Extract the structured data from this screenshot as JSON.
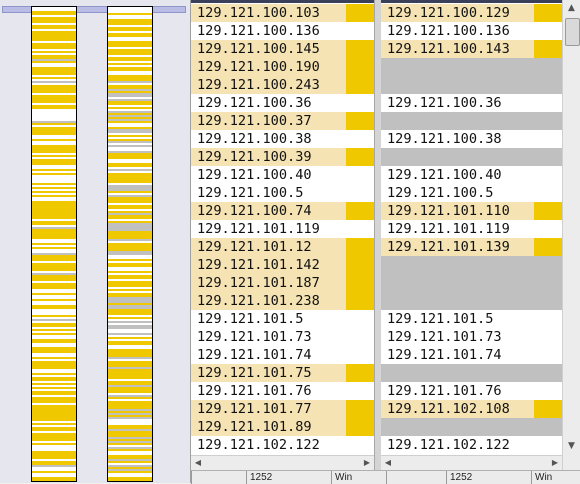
{
  "left_pane": {
    "rows": [
      {
        "text": "129.121.100.103",
        "state": "diff"
      },
      {
        "text": "129.121.100.136",
        "state": "same"
      },
      {
        "text": "129.121.100.145",
        "state": "diff"
      },
      {
        "text": "129.121.100.190",
        "state": "diff"
      },
      {
        "text": "129.121.100.243",
        "state": "diff"
      },
      {
        "text": "129.121.100.36",
        "state": "same"
      },
      {
        "text": "129.121.100.37",
        "state": "diff"
      },
      {
        "text": "129.121.100.38",
        "state": "same"
      },
      {
        "text": "129.121.100.39",
        "state": "diff"
      },
      {
        "text": "129.121.100.40",
        "state": "same"
      },
      {
        "text": "129.121.100.5",
        "state": "same"
      },
      {
        "text": "129.121.100.74",
        "state": "diff"
      },
      {
        "text": "129.121.101.119",
        "state": "same"
      },
      {
        "text": "129.121.101.12",
        "state": "diff"
      },
      {
        "text": "129.121.101.142",
        "state": "diff"
      },
      {
        "text": "129.121.101.187",
        "state": "diff"
      },
      {
        "text": "129.121.101.238",
        "state": "diff"
      },
      {
        "text": "129.121.101.5",
        "state": "same"
      },
      {
        "text": "129.121.101.73",
        "state": "same"
      },
      {
        "text": "129.121.101.74",
        "state": "same"
      },
      {
        "text": "129.121.101.75",
        "state": "diff"
      },
      {
        "text": "129.121.101.76",
        "state": "same"
      },
      {
        "text": "129.121.101.77",
        "state": "diff"
      },
      {
        "text": "129.121.101.89",
        "state": "diff"
      },
      {
        "text": "129.121.102.122",
        "state": "same"
      }
    ]
  },
  "right_pane": {
    "rows": [
      {
        "text": "129.121.100.129",
        "state": "diff"
      },
      {
        "text": "129.121.100.136",
        "state": "same"
      },
      {
        "text": "129.121.100.143",
        "state": "diff"
      },
      {
        "text": "",
        "state": "gap"
      },
      {
        "text": "",
        "state": "gap"
      },
      {
        "text": "129.121.100.36",
        "state": "same"
      },
      {
        "text": "",
        "state": "gap"
      },
      {
        "text": "129.121.100.38",
        "state": "same"
      },
      {
        "text": "",
        "state": "gap"
      },
      {
        "text": "129.121.100.40",
        "state": "same"
      },
      {
        "text": "129.121.100.5",
        "state": "same"
      },
      {
        "text": "129.121.101.110",
        "state": "diff"
      },
      {
        "text": "129.121.101.119",
        "state": "same"
      },
      {
        "text": "129.121.101.139",
        "state": "diff"
      },
      {
        "text": "",
        "state": "gap"
      },
      {
        "text": "",
        "state": "gap"
      },
      {
        "text": "",
        "state": "gap"
      },
      {
        "text": "129.121.101.5",
        "state": "same"
      },
      {
        "text": "129.121.101.73",
        "state": "same"
      },
      {
        "text": "129.121.101.74",
        "state": "same"
      },
      {
        "text": "",
        "state": "gap"
      },
      {
        "text": "129.121.101.76",
        "state": "same"
      },
      {
        "text": "129.121.102.108",
        "state": "diff"
      },
      {
        "text": "",
        "state": "gap"
      },
      {
        "text": "129.121.102.122",
        "state": "same"
      }
    ]
  },
  "statusbar": {
    "left": {
      "line": "1252",
      "eol": "Win"
    },
    "right": {
      "line": "1252",
      "eol": "Win"
    }
  },
  "colors": {
    "diff_row": "#f5e3b3",
    "diff_marker": "#f0c800",
    "gap_row": "#c0c0c0",
    "overview_bg": "#e6e6ee"
  },
  "icons": {
    "scroll_up": "up-arrow",
    "scroll_down": "down-arrow",
    "scroll_left": "left-arrow",
    "scroll_right": "right-arrow"
  }
}
